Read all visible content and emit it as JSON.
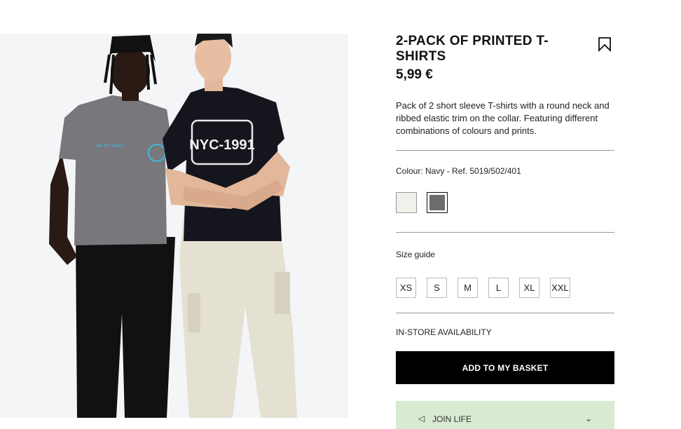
{
  "product": {
    "title": "2-PACK OF PRINTED T-SHIRTS",
    "price": "5,99 €",
    "description": "Pack of 2 short sleeve T-shirts with a round neck and ribbed elastic trim on the collar. Featuring different combinations of colours and prints.",
    "colour_line": "Colour: Navy - Ref. 5019/502/401",
    "swatches": [
      {
        "color": "#f1f0ea",
        "selected": false
      },
      {
        "color": "#6c6c6c",
        "selected": true
      }
    ],
    "size_guide": "Size guide",
    "sizes": [
      "XS",
      "S",
      "M",
      "L",
      "XL",
      "XXL"
    ],
    "store_availability": "IN-STORE AVAILABILITY",
    "add_to_basket": "ADD TO MY BASKET",
    "join_banner": "JOIN LIFE"
  },
  "image": {
    "left_tee_print": "live for today*",
    "right_tee_print": "NYC-1991"
  },
  "icons": {
    "bookmark": "bookmark-icon",
    "join_left": "leaf-icon",
    "join_right": "chevron-icon"
  }
}
